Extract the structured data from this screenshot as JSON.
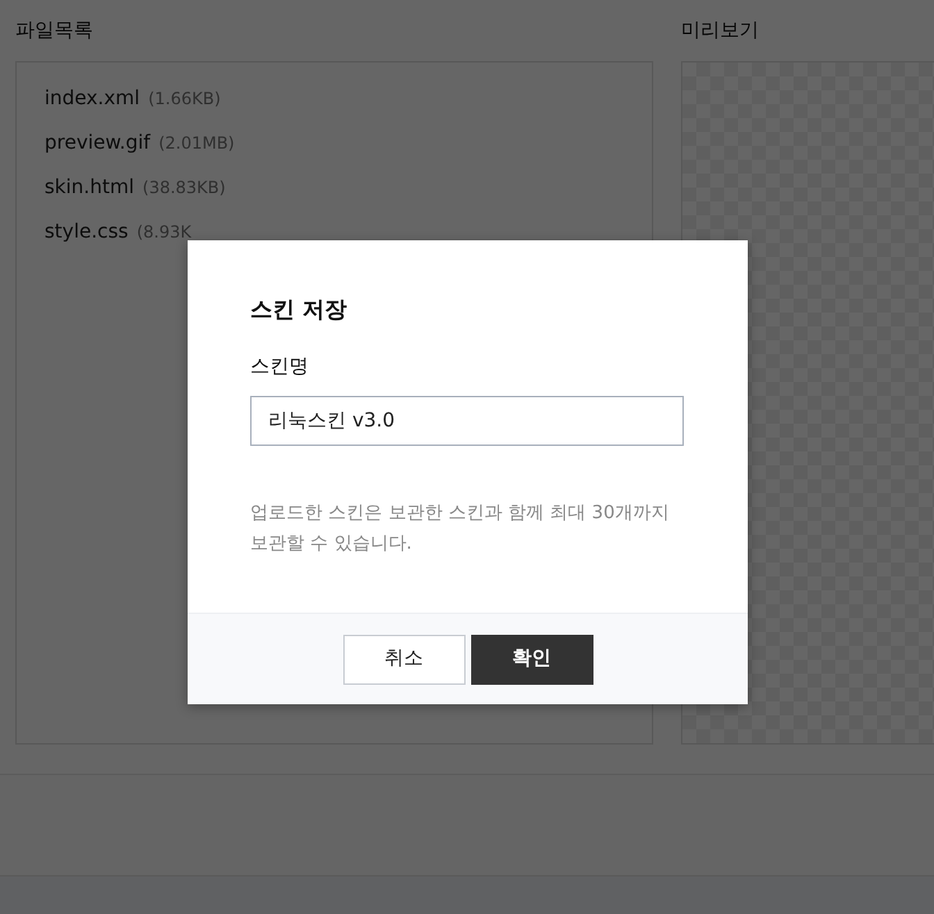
{
  "file_list": {
    "title": "파일목록",
    "files": [
      {
        "name": "index.xml",
        "size": "(1.66KB)"
      },
      {
        "name": "preview.gif",
        "size": "(2.01MB)"
      },
      {
        "name": "skin.html",
        "size": "(38.83KB)"
      },
      {
        "name": "style.css",
        "size": "(8.93K"
      }
    ]
  },
  "preview": {
    "title": "미리보기"
  },
  "dialog": {
    "title": "스킨 저장",
    "field_label": "스킨명",
    "field_value": "리눅스킨 v3.0",
    "note": "업로드한 스킨은 보관한 스킨과 함께 최대 30개까지 보관할 수 있습니다.",
    "buttons": [
      {
        "label": "취소",
        "kind": "secondary"
      },
      {
        "label": "확인",
        "kind": "primary"
      }
    ]
  }
}
